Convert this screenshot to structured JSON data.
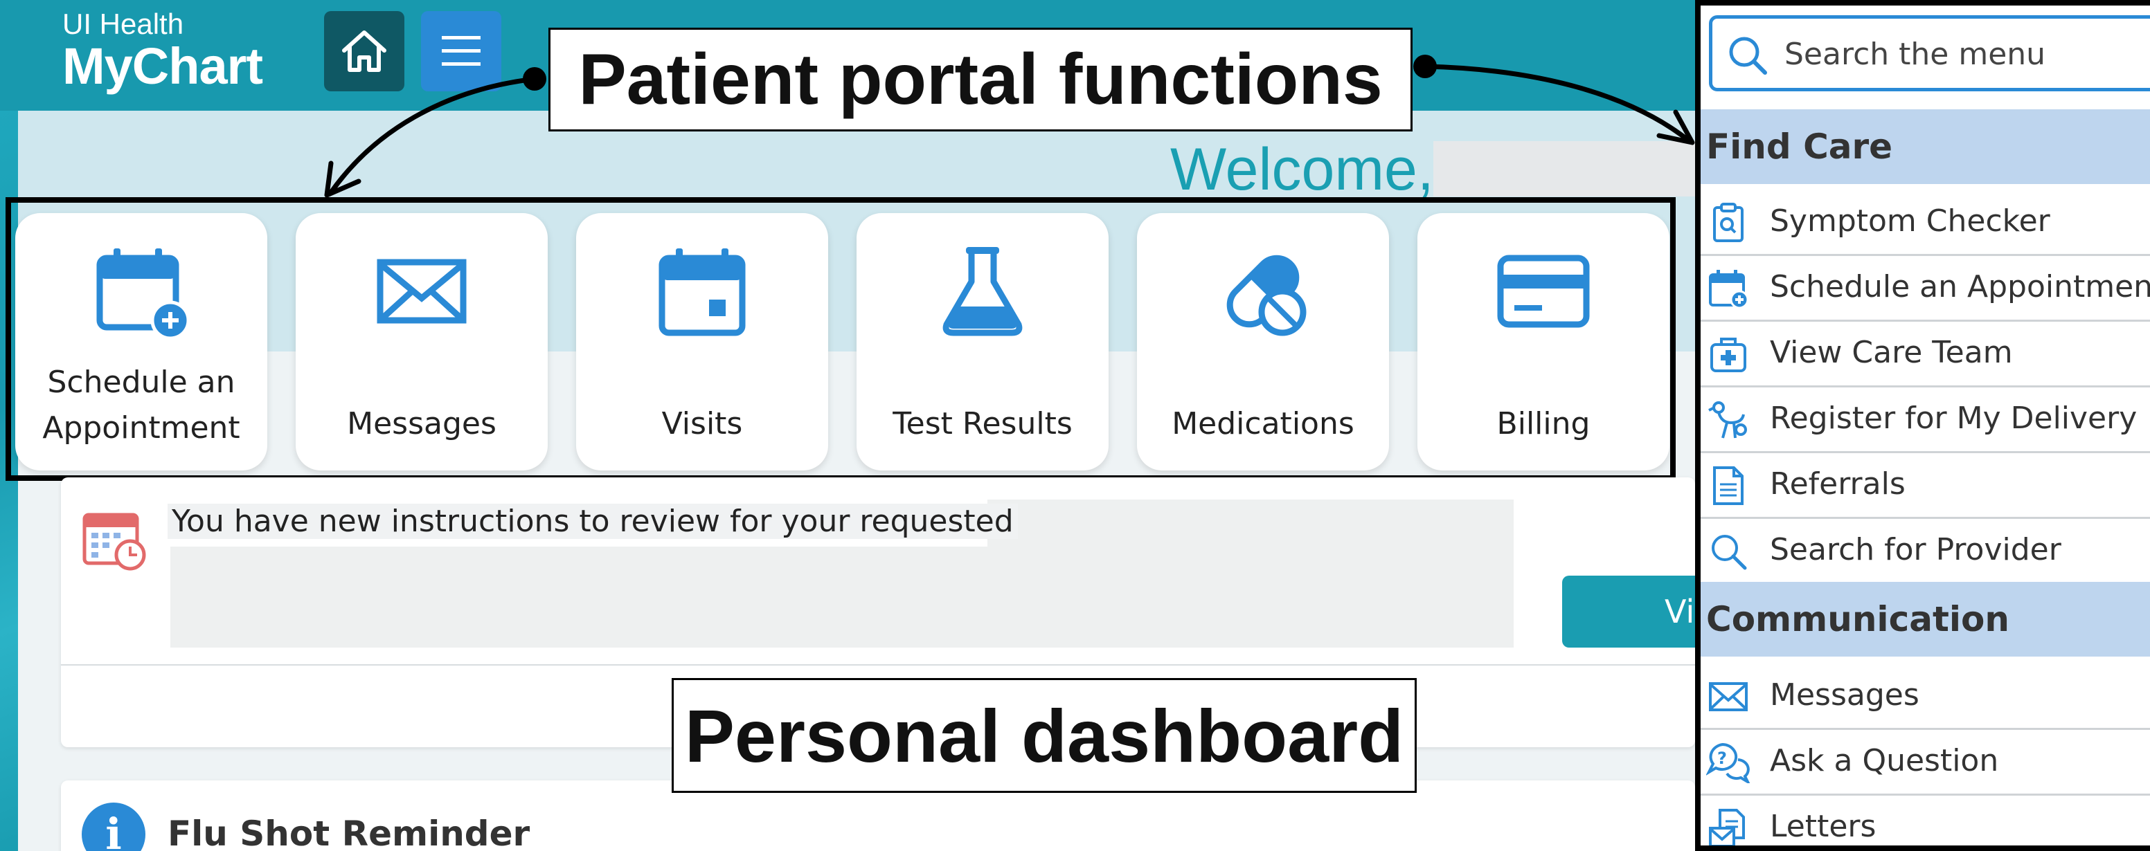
{
  "header": {
    "logo_top": "UI Health",
    "logo_main": "MyChart"
  },
  "welcome": "Welcome,",
  "tiles": [
    {
      "label_line1": "Schedule an",
      "label_line2": "Appointment",
      "icon": "calendar-plus-icon"
    },
    {
      "label": "Messages",
      "icon": "envelope-icon"
    },
    {
      "label": "Visits",
      "icon": "calendar-icon"
    },
    {
      "label": "Test Results",
      "icon": "flask-icon"
    },
    {
      "label": "Medications",
      "icon": "pills-icon"
    },
    {
      "label": "Billing",
      "icon": "credit-card-icon"
    }
  ],
  "notice": {
    "text": "You have new instructions to review for your requested",
    "button_partial": "Vi"
  },
  "flu": {
    "title": "Flu Shot Reminder"
  },
  "annotations": {
    "top": "Patient portal functions",
    "bottom": "Personal dashboard"
  },
  "menu": {
    "search_placeholder": "Search the menu",
    "sections": [
      {
        "title": "Find Care",
        "items": [
          {
            "label": "Symptom Checker",
            "icon": "symptom-checker-icon"
          },
          {
            "label": "Schedule an Appointment",
            "icon": "calendar-plus-icon"
          },
          {
            "label": "View Care Team",
            "icon": "care-team-icon"
          },
          {
            "label": "Register for My Delivery",
            "icon": "stork-icon"
          },
          {
            "label": "Referrals",
            "icon": "document-icon"
          },
          {
            "label": "Search for Provider",
            "icon": "search-icon"
          }
        ]
      },
      {
        "title": "Communication",
        "items": [
          {
            "label": "Messages",
            "icon": "envelope-icon"
          },
          {
            "label": "Ask a Question",
            "icon": "question-bubble-icon"
          },
          {
            "label": "Letters",
            "icon": "letters-icon"
          }
        ]
      }
    ]
  },
  "colors": {
    "header_teal": "#1899ae",
    "accent_blue": "#2a8ad6",
    "home_button": "#0f5864",
    "menu_section": "#bed5ee"
  }
}
